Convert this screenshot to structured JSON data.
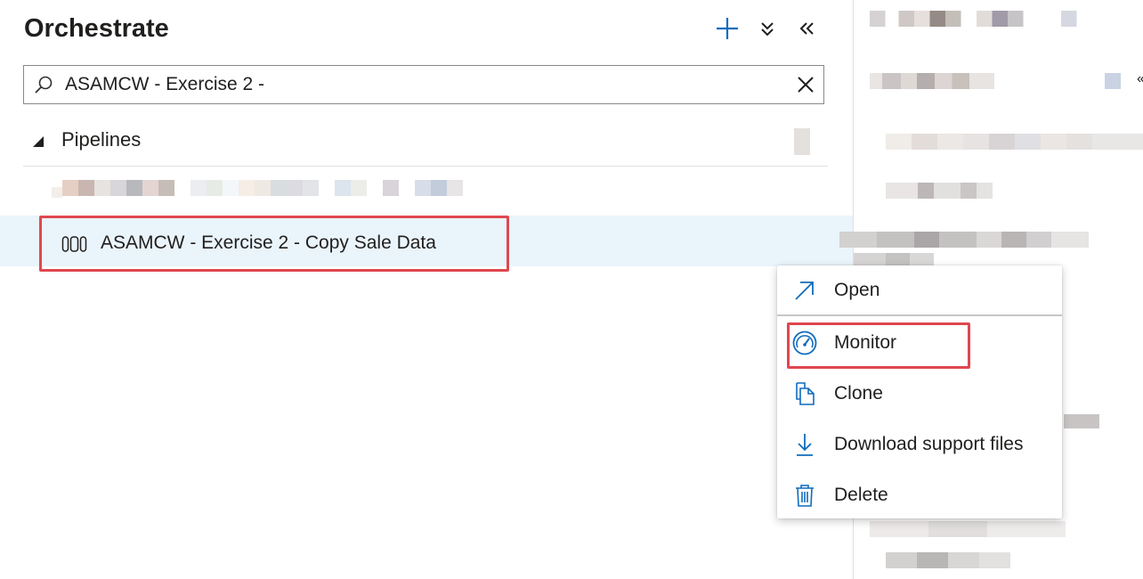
{
  "panel": {
    "title": "Orchestrate",
    "header_buttons": [
      {
        "name": "add",
        "icon": "plus-icon"
      },
      {
        "name": "collapse-all",
        "icon": "double-chevron-down-icon"
      },
      {
        "name": "collapse-panel",
        "icon": "double-chevron-left-icon"
      }
    ],
    "search": {
      "value": "ASAMCW - Exercise 2 -",
      "icon": "search-icon",
      "clear_icon": "close-icon"
    },
    "section": {
      "label": "Pipelines",
      "expanded": true
    },
    "pipelines": [
      {
        "label": "ASAMCW - Exercise 2 - Copy Sale Data",
        "icon": "pipeline-icon",
        "selected": true,
        "highlighted": true
      }
    ]
  },
  "context_menu": {
    "items": [
      {
        "label": "Open",
        "icon": "open-arrow-icon"
      },
      {
        "label": "Monitor",
        "icon": "gauge-icon",
        "highlighted": true
      },
      {
        "label": "Clone",
        "icon": "clone-icon"
      },
      {
        "label": "Download support files",
        "icon": "download-icon"
      },
      {
        "label": "Delete",
        "icon": "trash-icon"
      }
    ]
  },
  "colors": {
    "accent": "#0f6cbd",
    "highlight_border": "#e0474f",
    "selected_row": "#eaf4fb"
  }
}
